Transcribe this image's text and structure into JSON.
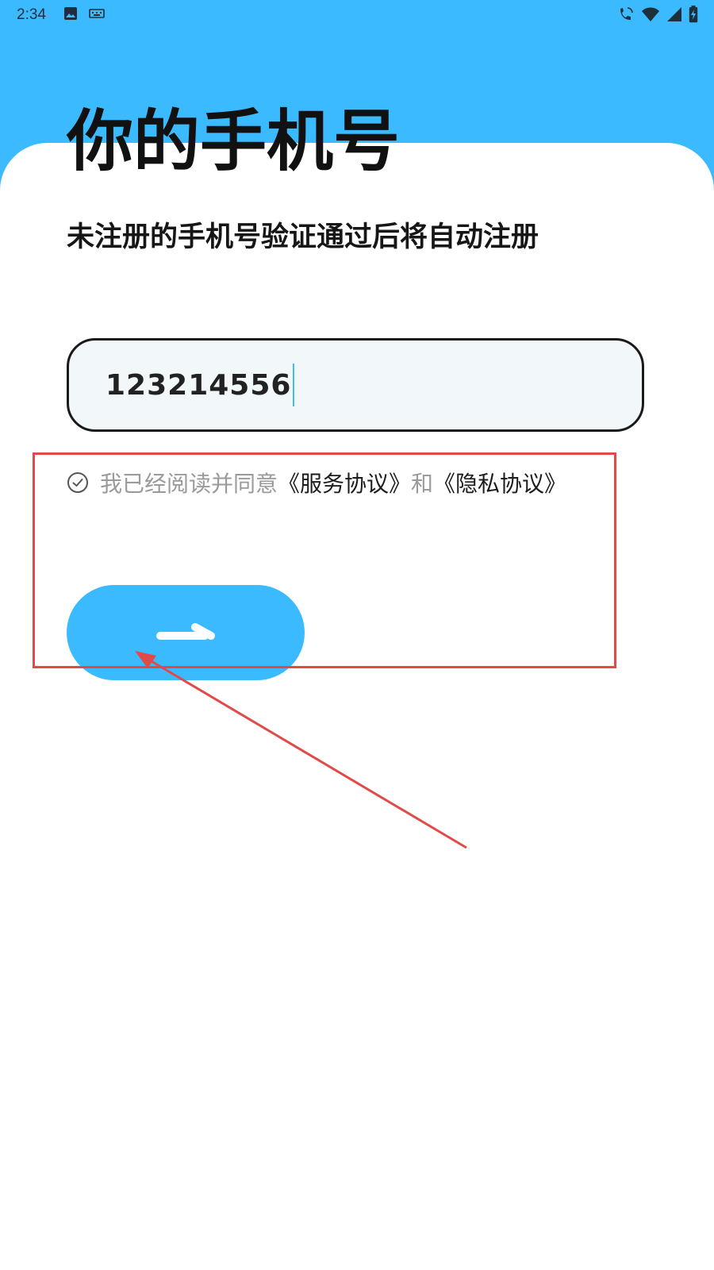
{
  "status_bar": {
    "time": "2:34",
    "left_icons": [
      "image-icon",
      "keyboard-icon"
    ],
    "right_icons": [
      "wifi-calling-icon",
      "wifi-icon",
      "signal-icon",
      "battery-charging-icon"
    ]
  },
  "header": {
    "title": "你的手机号",
    "subtitle": "未注册的手机号验证通过后将自动注册"
  },
  "form": {
    "phone_value": "123214556",
    "agreement_prefix": "我已经阅读并同意",
    "service_agreement": "《服务协议》",
    "conjunction": "和",
    "privacy_agreement": "《隐私协议》",
    "next_button_icon": "arrow-right-icon"
  },
  "annotation": {
    "box_color": "#e24a4a",
    "arrow_color": "#e24a4a"
  },
  "colors": {
    "accent": "#3bbaff",
    "title": "#111111",
    "muted": "#9a9a9a"
  }
}
